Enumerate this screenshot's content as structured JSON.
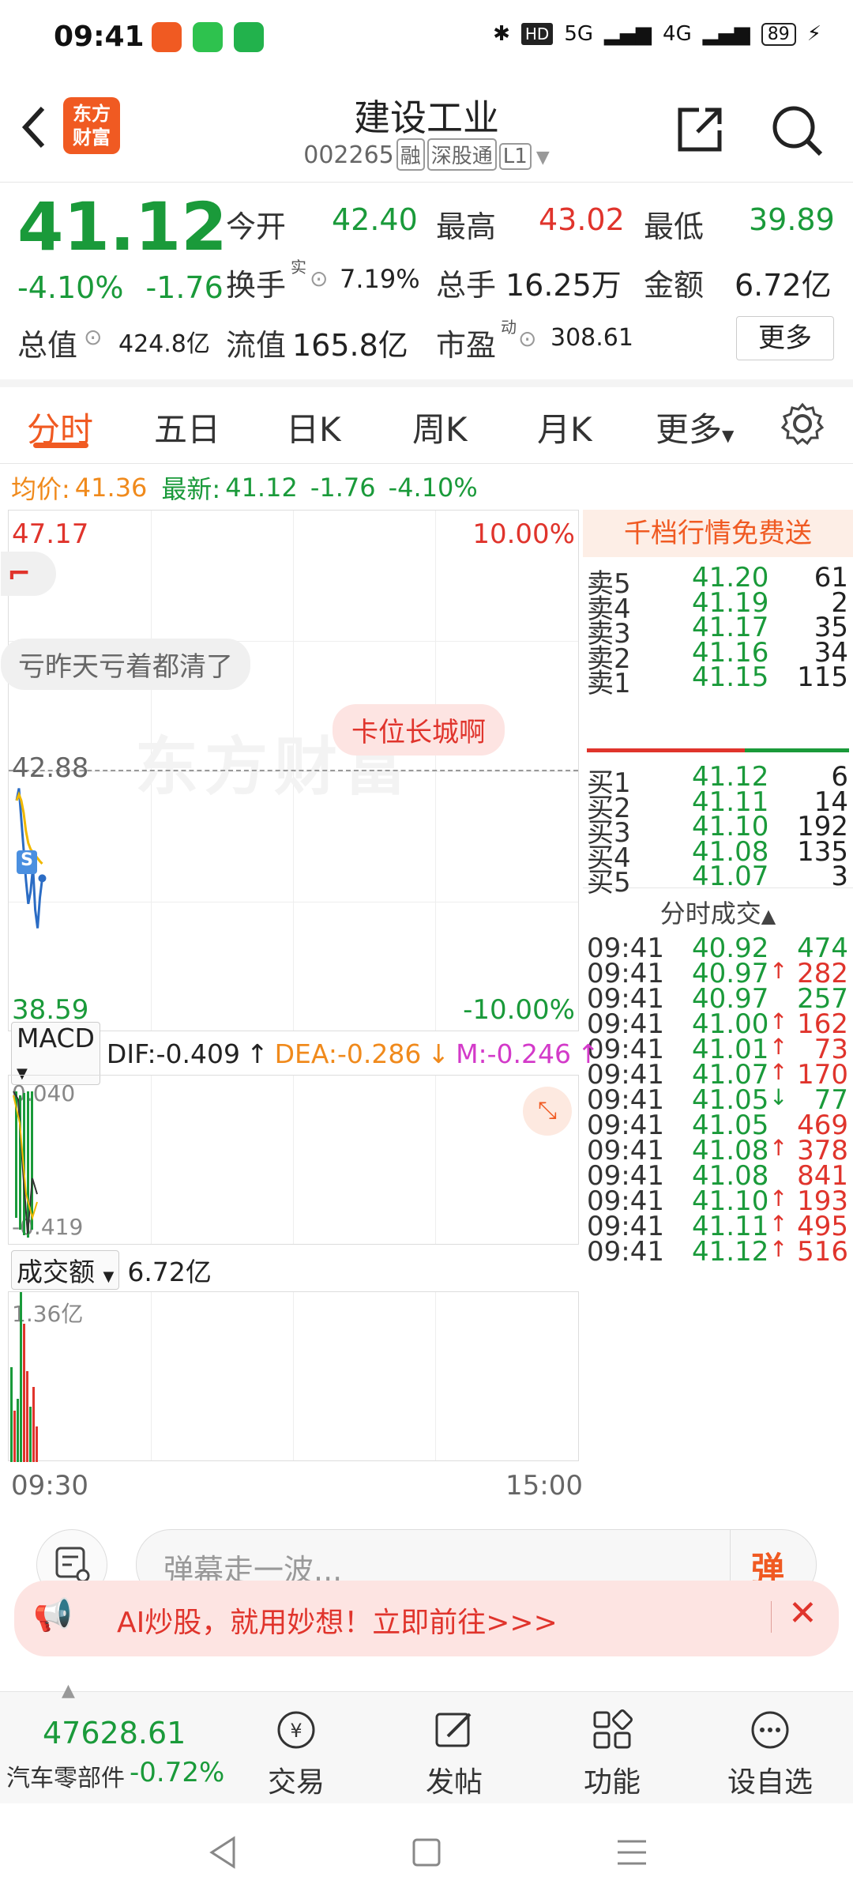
{
  "status": {
    "time": "09:41",
    "hd": "HD",
    "network": "5G",
    "network2": "4G",
    "battery": "89"
  },
  "header": {
    "logo_line1": "东方",
    "logo_line2": "财富",
    "title": "建设工业",
    "code": "002265",
    "tag_rong": "融",
    "tag_sgt": "深股通",
    "tag_level": "L1"
  },
  "quote": {
    "price": "41.12",
    "pct": "-4.10%",
    "chg": "-1.76",
    "open_label": "今开",
    "open": "42.40",
    "high_label": "最高",
    "high": "43.02",
    "low_label": "最低",
    "low": "39.89",
    "turnover_label": "换手",
    "turnover_sup": "实",
    "turnover": "7.19%",
    "volume_label": "总手",
    "volume": "16.25万",
    "amount_label": "金额",
    "amount": "6.72亿",
    "mcap_label": "总值",
    "mcap": "424.8亿",
    "float_label": "流值",
    "float": "165.8亿",
    "pe_label": "市盈",
    "pe_sup": "动",
    "pe": "308.61",
    "more_button": "更多"
  },
  "tabs": [
    "分时",
    "五日",
    "日K",
    "周K",
    "月K",
    "更多"
  ],
  "infoline": {
    "avg_label": "均价:",
    "avg": "41.36",
    "last_label": "最新:",
    "last": "41.12",
    "chg": "-1.76",
    "pct": "-4.10%"
  },
  "chart": {
    "upper": "47.17",
    "upper_pct": "10.00%",
    "lower": "38.59",
    "lower_pct": "-10.00%",
    "ref": "42.88",
    "time_start": "09:30",
    "time_end": "15:00",
    "watermark": "东方财富",
    "comment1": "亏昨天亏着都清了",
    "comment2": "卡位长城啊",
    "marker": "S"
  },
  "chart_data": {
    "type": "line",
    "x": [
      "09:30",
      "09:31",
      "09:32",
      "09:33",
      "09:34",
      "09:35",
      "09:36",
      "09:37",
      "09:38",
      "09:39",
      "09:40",
      "09:41"
    ],
    "series": [
      {
        "values": [
          42.4,
          42.6,
          42.1,
          41.6,
          41.1,
          40.7,
          40.9,
          41.3,
          40.6,
          40.3,
          40.8,
          41.12
        ]
      },
      {
        "values": [
          42.4,
          42.5,
          42.4,
          42.2,
          41.9,
          41.7,
          41.6,
          41.55,
          41.5,
          41.45,
          41.4,
          41.36
        ]
      }
    ],
    "ylim": [
      38.59,
      47.17
    ],
    "reference_line": 42.88,
    "xlim": [
      "09:30",
      "15:00"
    ]
  },
  "book": {
    "banner": "千档行情免费送",
    "asks": [
      {
        "label": "卖5",
        "price": "41.20",
        "vol": "61"
      },
      {
        "label": "卖4",
        "price": "41.19",
        "vol": "2"
      },
      {
        "label": "卖3",
        "price": "41.17",
        "vol": "35"
      },
      {
        "label": "卖2",
        "price": "41.16",
        "vol": "34"
      },
      {
        "label": "卖1",
        "price": "41.15",
        "vol": "115"
      }
    ],
    "bids": [
      {
        "label": "买1",
        "price": "41.12",
        "vol": "6"
      },
      {
        "label": "买2",
        "price": "41.11",
        "vol": "14"
      },
      {
        "label": "买3",
        "price": "41.10",
        "vol": "192"
      },
      {
        "label": "买4",
        "price": "41.08",
        "vol": "135"
      },
      {
        "label": "买5",
        "price": "41.07",
        "vol": "3"
      }
    ],
    "trades_title": "分时成交",
    "trades": [
      {
        "t": "09:41",
        "p": "40.92",
        "a": "",
        "v": "474",
        "vc": "green"
      },
      {
        "t": "09:41",
        "p": "40.97",
        "a": "↑",
        "v": "282",
        "vc": "red"
      },
      {
        "t": "09:41",
        "p": "40.97",
        "a": "",
        "v": "257",
        "vc": "green"
      },
      {
        "t": "09:41",
        "p": "41.00",
        "a": "↑",
        "v": "162",
        "vc": "red"
      },
      {
        "t": "09:41",
        "p": "41.01",
        "a": "↑",
        "v": "73",
        "vc": "red"
      },
      {
        "t": "09:41",
        "p": "41.07",
        "a": "↑",
        "v": "170",
        "vc": "red"
      },
      {
        "t": "09:41",
        "p": "41.05",
        "a": "↓",
        "v": "77",
        "vc": "green"
      },
      {
        "t": "09:41",
        "p": "41.05",
        "a": "",
        "v": "469",
        "vc": "red"
      },
      {
        "t": "09:41",
        "p": "41.08",
        "a": "↑",
        "v": "378",
        "vc": "red"
      },
      {
        "t": "09:41",
        "p": "41.08",
        "a": "",
        "v": "841",
        "vc": "red"
      },
      {
        "t": "09:41",
        "p": "41.10",
        "a": "↑",
        "v": "193",
        "vc": "red"
      },
      {
        "t": "09:41",
        "p": "41.11",
        "a": "↑",
        "v": "495",
        "vc": "red"
      },
      {
        "t": "09:41",
        "p": "41.12",
        "a": "↑",
        "v": "516",
        "vc": "red"
      }
    ]
  },
  "macd": {
    "selector": "MACD",
    "dif": "DIF:-0.409",
    "dea": "DEA:-0.286",
    "m": "M:-0.246",
    "top": "0.040",
    "bottom": "-0.419"
  },
  "volume": {
    "selector": "成交额",
    "value": "6.72亿",
    "top": "1.36亿"
  },
  "danmu": {
    "placeholder": "弹幕走一波...",
    "button": "弹"
  },
  "ad": {
    "text": "AI炒股，就用妙想！立即前往>>>"
  },
  "toolbar": {
    "index_value": "47628.61",
    "index_name": "汽车零部件",
    "index_pct": "-0.72%",
    "trade": "交易",
    "post": "发帖",
    "func": "功能",
    "watch": "设自选"
  },
  "colors": {
    "up": "#e0342c",
    "down": "#1a9a3a",
    "accent": "#f05a22"
  }
}
